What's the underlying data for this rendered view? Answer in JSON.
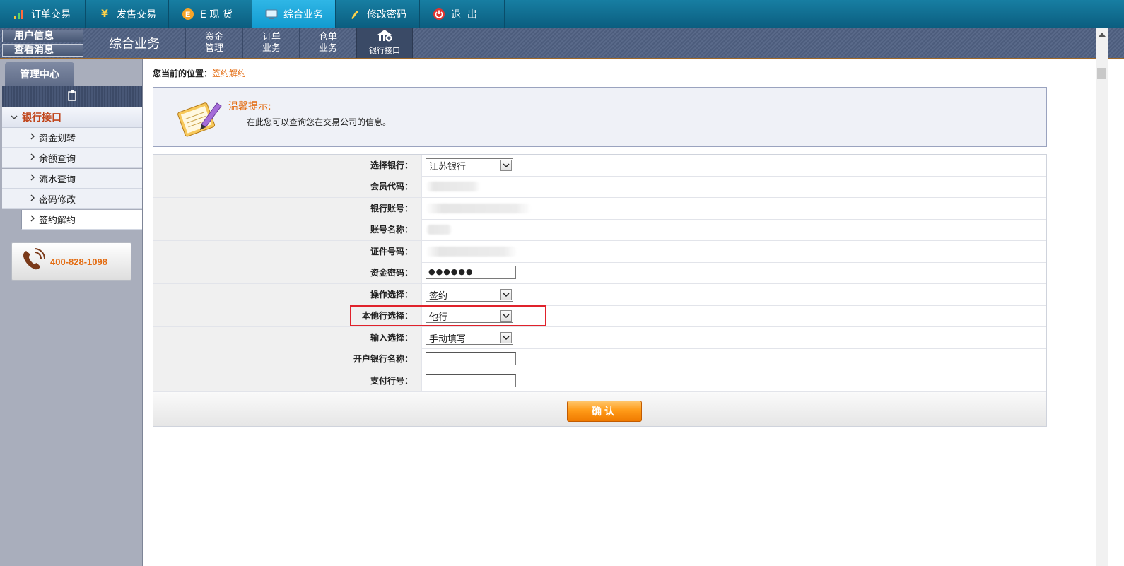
{
  "top_nav": {
    "tabs": [
      {
        "label": "订单交易",
        "icon": "bar-chart-icon"
      },
      {
        "label": "发售交易",
        "icon": "yen-icon"
      },
      {
        "label": "E 现 货",
        "icon": "e-circle-icon"
      },
      {
        "label": "综合业务",
        "icon": "monitor-icon",
        "active": true
      },
      {
        "label": "修改密码",
        "icon": "key-icon"
      },
      {
        "label": "退  出",
        "icon": "power-icon"
      }
    ]
  },
  "subbar": {
    "user_info": "用户信息",
    "view_messages": "查看消息",
    "title": "综合业务",
    "items": [
      "资金管理",
      "订单业务",
      "仓单业务"
    ],
    "bank_item": "银行接口"
  },
  "sidebar": {
    "tab": "管理中心",
    "group": "银行接口",
    "items": [
      {
        "label": "资金划转"
      },
      {
        "label": "余额查询"
      },
      {
        "label": "流水查询"
      },
      {
        "label": "密码修改"
      },
      {
        "label": "签约解约",
        "active": true
      }
    ],
    "phone": "400-828-1098"
  },
  "breadcrumb": {
    "prefix": "您当前的位置：",
    "current": "签约解约"
  },
  "tip": {
    "title": "温馨提示:",
    "text": "在此您可以查询您在交易公司的信息。"
  },
  "form": {
    "bank_label": "选择银行：",
    "bank_value": "江苏银行",
    "member_code_label": "会员代码：",
    "account_no_label": "银行账号：",
    "account_name_label": "账号名称：",
    "id_no_label": "证件号码：",
    "fund_pwd_label": "资金密码：",
    "fund_pwd_value": "●●●●●●",
    "operation_label": "操作选择：",
    "operation_value": "签约",
    "bank_type_label": "本他行选择：",
    "bank_type_value": "他行",
    "input_mode_label": "输入选择：",
    "input_mode_value": "手动填写",
    "open_bank_label": "开户银行名称：",
    "open_bank_value": "",
    "pay_no_label": "支付行号：",
    "pay_no_value": "",
    "confirm": "确认"
  },
  "colors": {
    "accent": "#e36b10",
    "nav": "#0b5e80",
    "highlight": "#e0222b"
  }
}
